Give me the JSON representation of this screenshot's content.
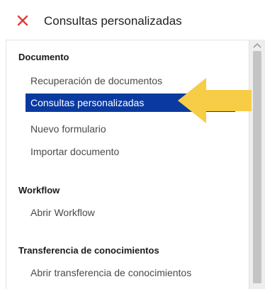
{
  "header": {
    "title": "Consultas personalizadas",
    "close_icon": "close-icon",
    "close_color": "#e53935"
  },
  "sections": [
    {
      "title": "Documento",
      "items": [
        {
          "label": "Recuperación de documentos",
          "selected": false
        },
        {
          "label": "Consultas personalizadas",
          "selected": true
        },
        {
          "label": "Nuevo formulario",
          "selected": false
        },
        {
          "label": "Importar documento",
          "selected": false
        }
      ]
    },
    {
      "title": "Workflow",
      "items": [
        {
          "label": "Abrir Workflow",
          "selected": false
        }
      ]
    },
    {
      "title": "Transferencia de conocimientos",
      "items": [
        {
          "label": "Abrir transferencia de conocimientos",
          "selected": false
        }
      ]
    }
  ],
  "colors": {
    "selected_background": "#0a3aa0",
    "arrow": "#f7cc46"
  },
  "icons": {
    "highlight_arrow": "arrow-left-icon",
    "scroll_up": "chevron-up-icon"
  }
}
